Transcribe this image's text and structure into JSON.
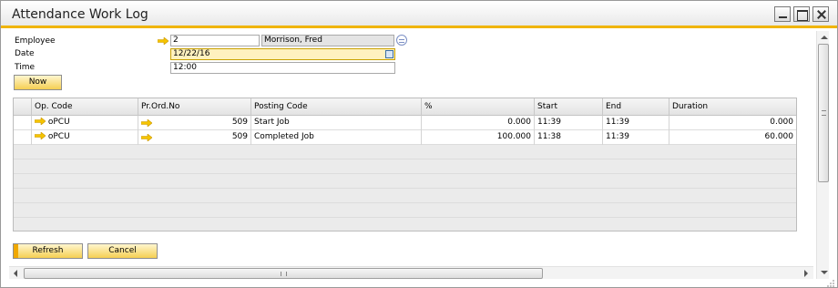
{
  "window": {
    "title": "Attendance Work Log"
  },
  "form": {
    "employee_label": "Employee",
    "employee_code": "2",
    "employee_name": "Morrison, Fred",
    "date_label": "Date",
    "date_value": "12/22/16",
    "time_label": "Time",
    "time_value": "12:00",
    "now_label": "Now"
  },
  "grid": {
    "columns": [
      "Op. Code",
      "Pr.Ord.No",
      "Posting Code",
      "%",
      "Start",
      "End",
      "Duration"
    ],
    "rows": [
      {
        "op_code": "oPCU",
        "pr_ord_no": "509",
        "posting_code": "Start Job",
        "percent": "0.000",
        "start": "11:39",
        "end": "11:39",
        "duration": "0.000"
      },
      {
        "op_code": "oPCU",
        "pr_ord_no": "509",
        "posting_code": "Completed Job",
        "percent": "100.000",
        "start": "11:38",
        "end": "11:39",
        "duration": "60.000"
      }
    ]
  },
  "buttons": {
    "refresh": "Refresh",
    "cancel": "Cancel"
  },
  "colors": {
    "accent": "#f0b400",
    "link_arrow": "#f5c400",
    "active_field": "#fff1bf"
  }
}
